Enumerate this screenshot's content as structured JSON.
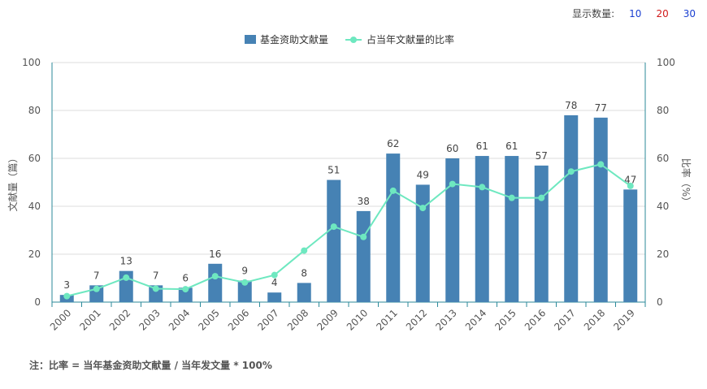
{
  "header": {
    "display_label": "显示数量:",
    "options": [
      {
        "label": "10",
        "color": "#1a3fd1"
      },
      {
        "label": "20",
        "color": "#d11a1a"
      },
      {
        "label": "30",
        "color": "#1a3fd1"
      }
    ]
  },
  "footnote": "注：比率 = 当年基金资助文献量 / 当年发文量 * 100%",
  "chart_data": {
    "type": "bar",
    "categories": [
      "2000",
      "2001",
      "2002",
      "2003",
      "2004",
      "2005",
      "2006",
      "2007",
      "2008",
      "2009",
      "2010",
      "2011",
      "2012",
      "2013",
      "2014",
      "2015",
      "2016",
      "2017",
      "2018",
      "2019"
    ],
    "series": [
      {
        "name": "基金资助文献量",
        "type": "bar",
        "axis": "left",
        "color": "#4682b4",
        "values": [
          3,
          7,
          13,
          7,
          6,
          16,
          9,
          4,
          8,
          51,
          38,
          62,
          49,
          60,
          61,
          61,
          57,
          78,
          77,
          47
        ]
      },
      {
        "name": "占当年文献量的比率",
        "type": "line",
        "axis": "right",
        "color": "#6ee8c0",
        "values": [
          2.5,
          5.5,
          10.2,
          5.6,
          5.4,
          10.8,
          8.2,
          11.3,
          21.5,
          31.5,
          27.2,
          46.5,
          39.3,
          49.3,
          48.0,
          43.5,
          43.5,
          54.5,
          57.5,
          48.5
        ]
      }
    ],
    "ylabel": "文献量（篇）",
    "y2label": "比率（%）",
    "ylim": [
      0,
      100
    ],
    "y2lim": [
      0,
      100
    ],
    "yticks": [
      0,
      20,
      40,
      60,
      80,
      100
    ],
    "y2ticks": [
      0,
      20,
      40,
      60,
      80,
      100
    ],
    "grid": true,
    "legend_position": "top-center"
  }
}
